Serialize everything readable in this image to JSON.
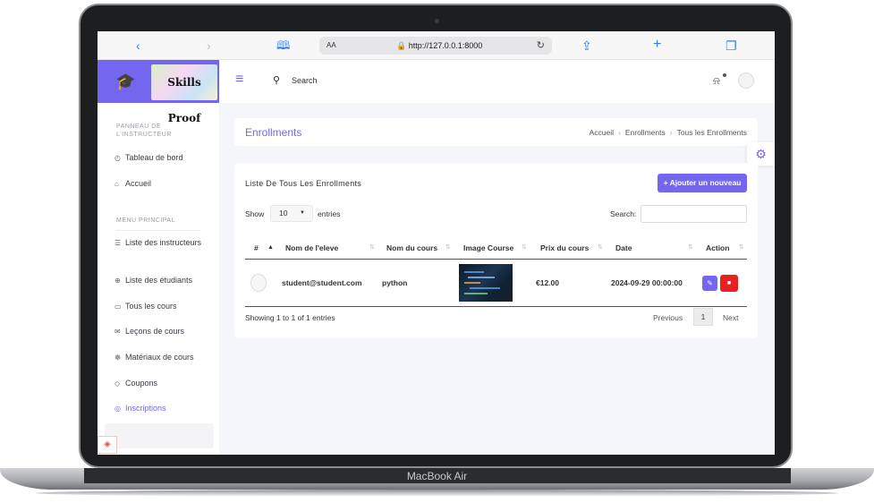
{
  "device": {
    "label": "MacBook Air"
  },
  "browser": {
    "text_size_label": "AA",
    "url": "http://127.0.0.1:8000",
    "icons": [
      "chevron-left-icon",
      "chevron-right-icon",
      "book-icon",
      "lock-icon",
      "reload-icon",
      "share-icon",
      "plus-icon",
      "tabs-icon"
    ]
  },
  "brand": {
    "logo_text": "Skills Proof",
    "accent": "#7367f0"
  },
  "sidebar": {
    "section_instructor": "PANNEAU DE L'INSTRUCTEUR",
    "section_main": "MENU PRINCIPAL",
    "items": [
      {
        "label": "Tableau de bord",
        "icon": "dashboard-icon"
      },
      {
        "label": "Accueil",
        "icon": "home-icon"
      },
      {
        "label": "Liste des instructeurs",
        "icon": "list-icon"
      },
      {
        "label": "Liste des étudiants",
        "icon": "users-icon"
      },
      {
        "label": "Tous les cours",
        "icon": "book-icon"
      },
      {
        "label": "Leçons de cours",
        "icon": "lesson-icon"
      },
      {
        "label": "Matériaux de cours",
        "icon": "materials-icon"
      },
      {
        "label": "Coupons",
        "icon": "tag-icon"
      },
      {
        "label": "Inscriptions",
        "icon": "enroll-icon",
        "active": true
      }
    ]
  },
  "topnav": {
    "search_label": "Search"
  },
  "header": {
    "title": "Enrollments",
    "breadcrumb": [
      "Accueil",
      "Enrollments",
      "Tous les Enrollments"
    ]
  },
  "table_card": {
    "title": "Liste De Tous Les Enrollments",
    "add_button": "+ Ajouter un nouveau",
    "show_label": "Show",
    "page_size": "10",
    "entries_label": "entries",
    "search_label": "Search:",
    "search_value": "",
    "columns": [
      "#",
      "Nom de l'eleve",
      "Nom du cours",
      "Image Course",
      "Prix du cours",
      "Date",
      "Action"
    ],
    "rows": [
      {
        "student": "student@student.com",
        "course": "python",
        "price": "€12.00",
        "date": "2024-09-29 00:00:00"
      }
    ],
    "summary": "Showing 1 to 1 of 1 entries",
    "pagination": {
      "prev": "Previous",
      "current": "1",
      "next": "Next"
    }
  },
  "colors": {
    "primary": "#7367f0",
    "danger": "#ea2020",
    "page_bg": "#f5f6f9"
  }
}
